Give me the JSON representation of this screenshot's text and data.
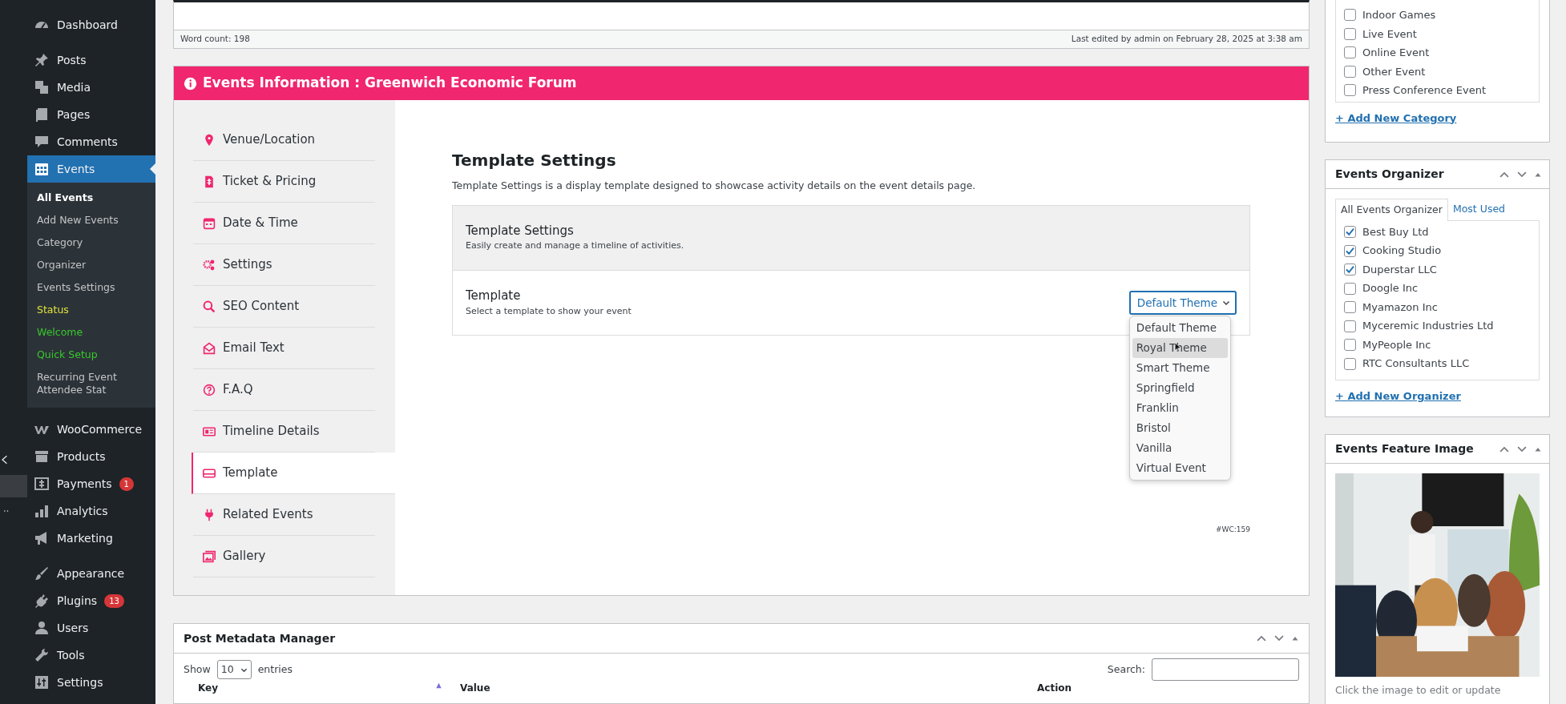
{
  "admin_menu": {
    "groups": [
      [
        {
          "label": "Dashboard",
          "selected": false
        }
      ],
      [
        {
          "label": "Posts",
          "selected": false
        },
        {
          "label": "Media",
          "selected": false
        },
        {
          "label": "Pages",
          "selected": false
        },
        {
          "label": "Comments",
          "selected": false
        },
        {
          "label": "Events",
          "selected": true,
          "submenu": [
            {
              "label": "All Events",
              "selected": true
            },
            {
              "label": "Add New Events",
              "selected": false
            },
            {
              "label": "Category",
              "selected": false
            },
            {
              "label": "Organizer",
              "selected": false
            },
            {
              "label": "Events Settings",
              "selected": false
            },
            {
              "label": "Status",
              "selected": false,
              "color": "#dde03a"
            },
            {
              "label": "Welcome",
              "selected": false,
              "color": "#38c72e"
            },
            {
              "label": "Quick Setup",
              "selected": false,
              "color": "#38c72e"
            },
            {
              "label": "Recurring Event Attendee Stat",
              "selected": false
            }
          ]
        }
      ],
      [
        {
          "label": "WooCommerce",
          "selected": false
        },
        {
          "label": "Products",
          "selected": false
        },
        {
          "label": "Payments",
          "selected": false,
          "badge": "1"
        },
        {
          "label": "Analytics",
          "selected": false
        },
        {
          "label": "Marketing",
          "selected": false
        }
      ],
      [
        {
          "label": "Appearance",
          "selected": false
        },
        {
          "label": "Plugins",
          "selected": false,
          "badge": "13"
        },
        {
          "label": "Users",
          "selected": false
        },
        {
          "label": "Tools",
          "selected": false
        },
        {
          "label": "Settings",
          "selected": false
        }
      ]
    ]
  },
  "editor": {
    "word_count": "Word count: 198",
    "last_edited": "Last edited by admin on February 28, 2025 at 3:38 am"
  },
  "events_info": {
    "title": "Events Information : Greenwich Economic Forum",
    "tabs": [
      {
        "label": "Venue/Location",
        "selected": false
      },
      {
        "label": "Ticket & Pricing",
        "selected": false
      },
      {
        "label": "Date & Time",
        "selected": false
      },
      {
        "label": "Settings",
        "selected": false
      },
      {
        "label": "SEO Content",
        "selected": false
      },
      {
        "label": "Email Text",
        "selected": false
      },
      {
        "label": "F.A.Q",
        "selected": false
      },
      {
        "label": "Timeline Details",
        "selected": false
      },
      {
        "label": "Template",
        "selected": true
      },
      {
        "label": "Related Events",
        "selected": false
      },
      {
        "label": "Gallery",
        "selected": false
      }
    ],
    "heading": "Template Settings",
    "description": "Template Settings is a display template designed to showcase activity details on the event details page.",
    "box_title": "Template Settings",
    "box_subtitle": "Easily create and manage a timeline of activities.",
    "field": {
      "label": "Template",
      "hint": "Select a template to show your event",
      "value": "Default Theme",
      "expanded": true,
      "options": [
        {
          "label": "Default Theme",
          "highlighted": false
        },
        {
          "label": "Royal Theme",
          "highlighted": true
        },
        {
          "label": "Smart Theme",
          "highlighted": false
        },
        {
          "label": "Springfield",
          "highlighted": false
        },
        {
          "label": "Franklin",
          "highlighted": false
        },
        {
          "label": "Bristol",
          "highlighted": false
        },
        {
          "label": "Vanilla",
          "highlighted": false
        },
        {
          "label": "Virtual Event",
          "highlighted": false
        }
      ]
    },
    "footer": "#WC:159"
  },
  "metadata": {
    "title": "Post Metadata Manager",
    "show_label": "Show",
    "page_size": "10",
    "entries_label": "entries",
    "search_label": "Search:",
    "columns": [
      "Key",
      "Value",
      "Action"
    ]
  },
  "category_box": {
    "items": [
      {
        "label": "Indoor Games",
        "checked": false
      },
      {
        "label": "Live Event",
        "checked": false
      },
      {
        "label": "Online Event",
        "checked": false
      },
      {
        "label": "Other Event",
        "checked": false
      },
      {
        "label": "Press Conference Event",
        "checked": false
      }
    ],
    "link": "+ Add New Category"
  },
  "organizer_box": {
    "title": "Events Organizer",
    "tabs": [
      {
        "label": "All Events Organizer",
        "selected": true
      },
      {
        "label": "Most Used",
        "selected": false
      }
    ],
    "items": [
      {
        "label": "Best Buy Ltd",
        "checked": true
      },
      {
        "label": "Cooking Studio",
        "checked": true
      },
      {
        "label": "Duperstar LLC",
        "checked": true
      },
      {
        "label": "Doogle Inc",
        "checked": false
      },
      {
        "label": "Myamazon Inc",
        "checked": false
      },
      {
        "label": "Myceremic Industries Ltd",
        "checked": false
      },
      {
        "label": "MyPeople Inc",
        "checked": false
      },
      {
        "label": "RTC Consultants LLC",
        "checked": false
      }
    ],
    "link": "+ Add New Organizer"
  },
  "feature_box": {
    "title": "Events Feature Image",
    "caption": "Click the image to edit or update"
  }
}
